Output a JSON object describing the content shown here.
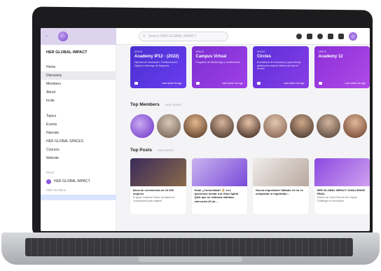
{
  "topbar": {
    "search_placeholder": "Search HER GLOBAL IMPACT"
  },
  "sidebar": {
    "title": "HER GLOBAL IMPACT",
    "items": [
      {
        "label": "Home"
      },
      {
        "label": "Discovery"
      },
      {
        "label": "Members"
      },
      {
        "label": "About"
      },
      {
        "label": "Invite"
      }
    ],
    "items2": [
      {
        "label": "Topics"
      },
      {
        "label": "Events"
      },
      {
        "label": "Hiervids"
      },
      {
        "label": "HER GLOBAL SPACES"
      },
      {
        "label": "Courses"
      },
      {
        "label": "Website"
      }
    ],
    "section_label": "PAST",
    "brand_label": "HER GLOBAL IMPACT",
    "section_label2": "HER GLOBAL"
  },
  "courses": [
    {
      "kicker": "SPACE",
      "title": "Academy IP12 · (2022)",
      "desc": "Diploma de Innovación, Transformación Digital y Liderazgo de Negocios",
      "footer": "Last online 5h ago"
    },
    {
      "kicker": "SPACE",
      "title": "Campus Virtual",
      "desc": "Programa de Mentorazgo y conferencias",
      "footer": "Last online 11h ago"
    },
    {
      "kicker": "SPACE",
      "title": "Circles",
      "desc": "Ecosistema de innovación y aprendizaje global para mujeres líderes de todo el mundo",
      "footer": "Last online 4m ago"
    },
    {
      "kicker": "SPACE",
      "title": "Academy 12",
      "desc": "",
      "footer": "Last online 4m ago"
    }
  ],
  "members_section": {
    "title": "Top Members",
    "link": "SEE MORE"
  },
  "posts_section": {
    "title": "Top Posts",
    "link": "SEE MORE"
  },
  "posts": [
    {
      "title": "Beca de crecimiento de 10.000 mujeres",
      "desc": "El grupo Goldman Sachs ha abierto la convocatoria para mujeres"
    },
    {
      "title": "Hola! ¿Comunidad? 🎉 Les queremos invitar a la Gran Spiral Q&A que se realizará mañana, miércoles 26 de...",
      "desc": ""
    },
    {
      "title": "Nueva importante! Sábado 14 no es comprado ni registrado...",
      "desc": ""
    },
    {
      "title": "HER GLOBAL IMPACT CHALLENGE FINAL",
      "desc": "Sincero de Gran Final de Her Impact Challenge en Innovación"
    }
  ],
  "colors": {
    "accent": "#6a3df0",
    "sidebar_header_bg": "#dcd3ee"
  }
}
